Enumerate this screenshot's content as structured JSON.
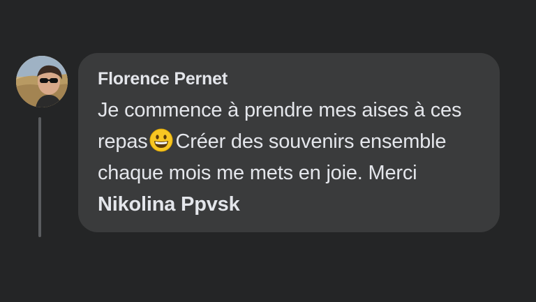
{
  "comment": {
    "author": "Florence Pernet",
    "text_part1": "Je commence à prendre mes aises à ces repas",
    "emoji": "grinning-face-emoji",
    "text_part2": "Créer des souvenirs ensemble chaque mois me mets en joie. Merci",
    "mention": "Nikolina Ppvsk"
  },
  "colors": {
    "background": "#242526",
    "bubble": "#3a3b3c",
    "text": "#e4e6eb",
    "thread_line": "#5a5c5f"
  }
}
